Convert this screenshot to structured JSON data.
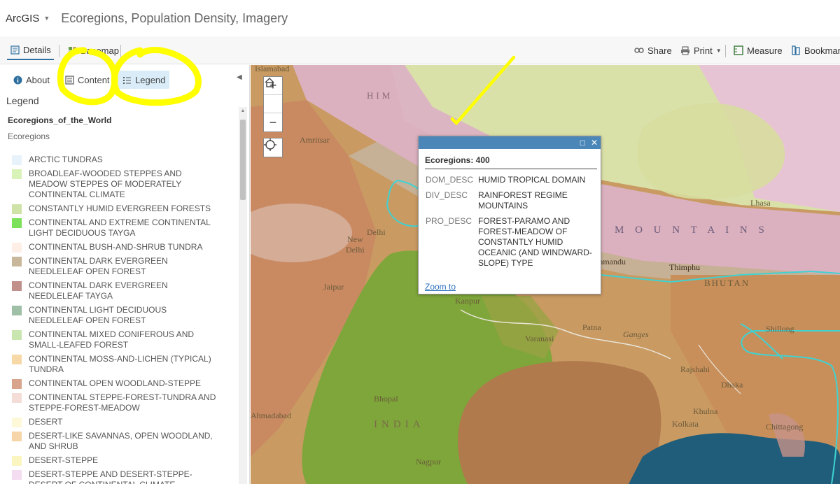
{
  "header": {
    "brand": "ArcGIS",
    "title": "Ecoregions, Population Density, Imagery"
  },
  "toolbar": {
    "details": "Details",
    "basemap": "Basemap",
    "share": "Share",
    "print": "Print",
    "measure": "Measure",
    "bookmarks": "Bookmar"
  },
  "sidebar": {
    "tabs": {
      "about": "About",
      "content": "Content",
      "legend": "Legend"
    },
    "heading": "Legend",
    "layer_name": "Ecoregions_of_the_World",
    "layer_sub": "Ecoregions",
    "legend_items": [
      {
        "label": "ARCTIC TUNDRAS",
        "color": "#e8f2fb"
      },
      {
        "label": "BROADLEAF-WOODED STEPPES AND MEADOW STEPPES OF MODERATELY CONTINENTAL CLIMATE",
        "color": "#d9f2b8"
      },
      {
        "label": "CONSTANTLY HUMID EVERGREEN FORESTS",
        "color": "#cfe3a9"
      },
      {
        "label": "CONTINENTAL AND EXTREME CONTINENTAL LIGHT DECIDUOUS TAYGA",
        "color": "#7be05a"
      },
      {
        "label": "CONTINENTAL BUSH-AND-SHRUB TUNDRA",
        "color": "#fdeee6"
      },
      {
        "label": "CONTINENTAL DARK EVERGREEN NEEDLELEAF OPEN FOREST",
        "color": "#c8b79a"
      },
      {
        "label": "CONTINENTAL DARK EVERGREEN NEEDLELEAF TAYGA",
        "color": "#c2908a"
      },
      {
        "label": "CONTINENTAL LIGHT DECIDUOUS NEEDLELEAF OPEN FOREST",
        "color": "#9fbfa6"
      },
      {
        "label": "CONTINENTAL MIXED CONIFEROUS AND SMALL-LEAFED FOREST",
        "color": "#c9e6b0"
      },
      {
        "label": "CONTINENTAL MOSS-AND-LICHEN (TYPICAL) TUNDRA",
        "color": "#f7d9a8"
      },
      {
        "label": "CONTINENTAL OPEN WOODLAND-STEPPE",
        "color": "#d9a48c"
      },
      {
        "label": "CONTINENTAL STEPPE-FOREST-TUNDRA AND STEPPE-FOREST-MEADOW",
        "color": "#f3ddd6"
      },
      {
        "label": "DESERT",
        "color": "#fdf8d8"
      },
      {
        "label": "DESERT-LIKE SAVANNAS, OPEN WOODLAND, AND SHRUB",
        "color": "#f6d6a8"
      },
      {
        "label": "DESERT-STEPPE",
        "color": "#fbf6c0"
      },
      {
        "label": "DESERT-STEPPE AND DESERT-STEPPE-DESERT OF CONTINENTAL CLIMATE",
        "color": "#f4ddf0"
      }
    ]
  },
  "map": {
    "places": {
      "islamabad": "Islamabad",
      "amritsar": "Amritsar",
      "new_delhi": "New\nDelhi",
      "delhi": "Delhi",
      "jaipur": "Jaipur",
      "kanpur": "Kanpur",
      "patna": "Patna",
      "ganges": "Ganges",
      "varanasi": "Varanasi",
      "bhopal": "Bhopal",
      "india": "INDIA",
      "ahmadabad": "Ahmadabad",
      "nagpur": "Nagpur",
      "kathmandu": "Kathmandu",
      "thimphu": "Thimphu",
      "bhutan": "BHUTAN",
      "lhasa": "Lhasa",
      "mountains": "M O U N T A I N S",
      "him": "HIM",
      "shillong": "Shillong",
      "rajshahi": "Rajshahi",
      "dhaka": "Dhaka",
      "khulna": "Khulna",
      "kolkata": "Kolkata",
      "chittagong": "Chittagong"
    },
    "zoom_in": "+",
    "zoom_out": "−"
  },
  "popup": {
    "title": "Ecoregions: 400",
    "attributes": [
      {
        "key": "DOM_DESC",
        "value": "HUMID TROPICAL DOMAIN"
      },
      {
        "key": "DIV_DESC",
        "value": "RAINFOREST REGIME MOUNTAINS"
      },
      {
        "key": "PRO_DESC",
        "value": "FOREST-PARAMO AND FOREST-MEADOW OF CONSTANTLY HUMID OCEANIC (AND WINDWARD-SLOPE) TYPE"
      }
    ],
    "zoom_to": "Zoom to"
  },
  "colors": {
    "accent": "#2f6f9f",
    "popup_bar": "#4a86b7",
    "annotation": "#ffff00"
  },
  "icons": {
    "about": "info-icon",
    "content": "content-icon",
    "legend": "legend-icon",
    "share": "share-icon",
    "print": "print-icon",
    "measure": "measure-icon",
    "bookmarks": "bookmark-icon"
  }
}
